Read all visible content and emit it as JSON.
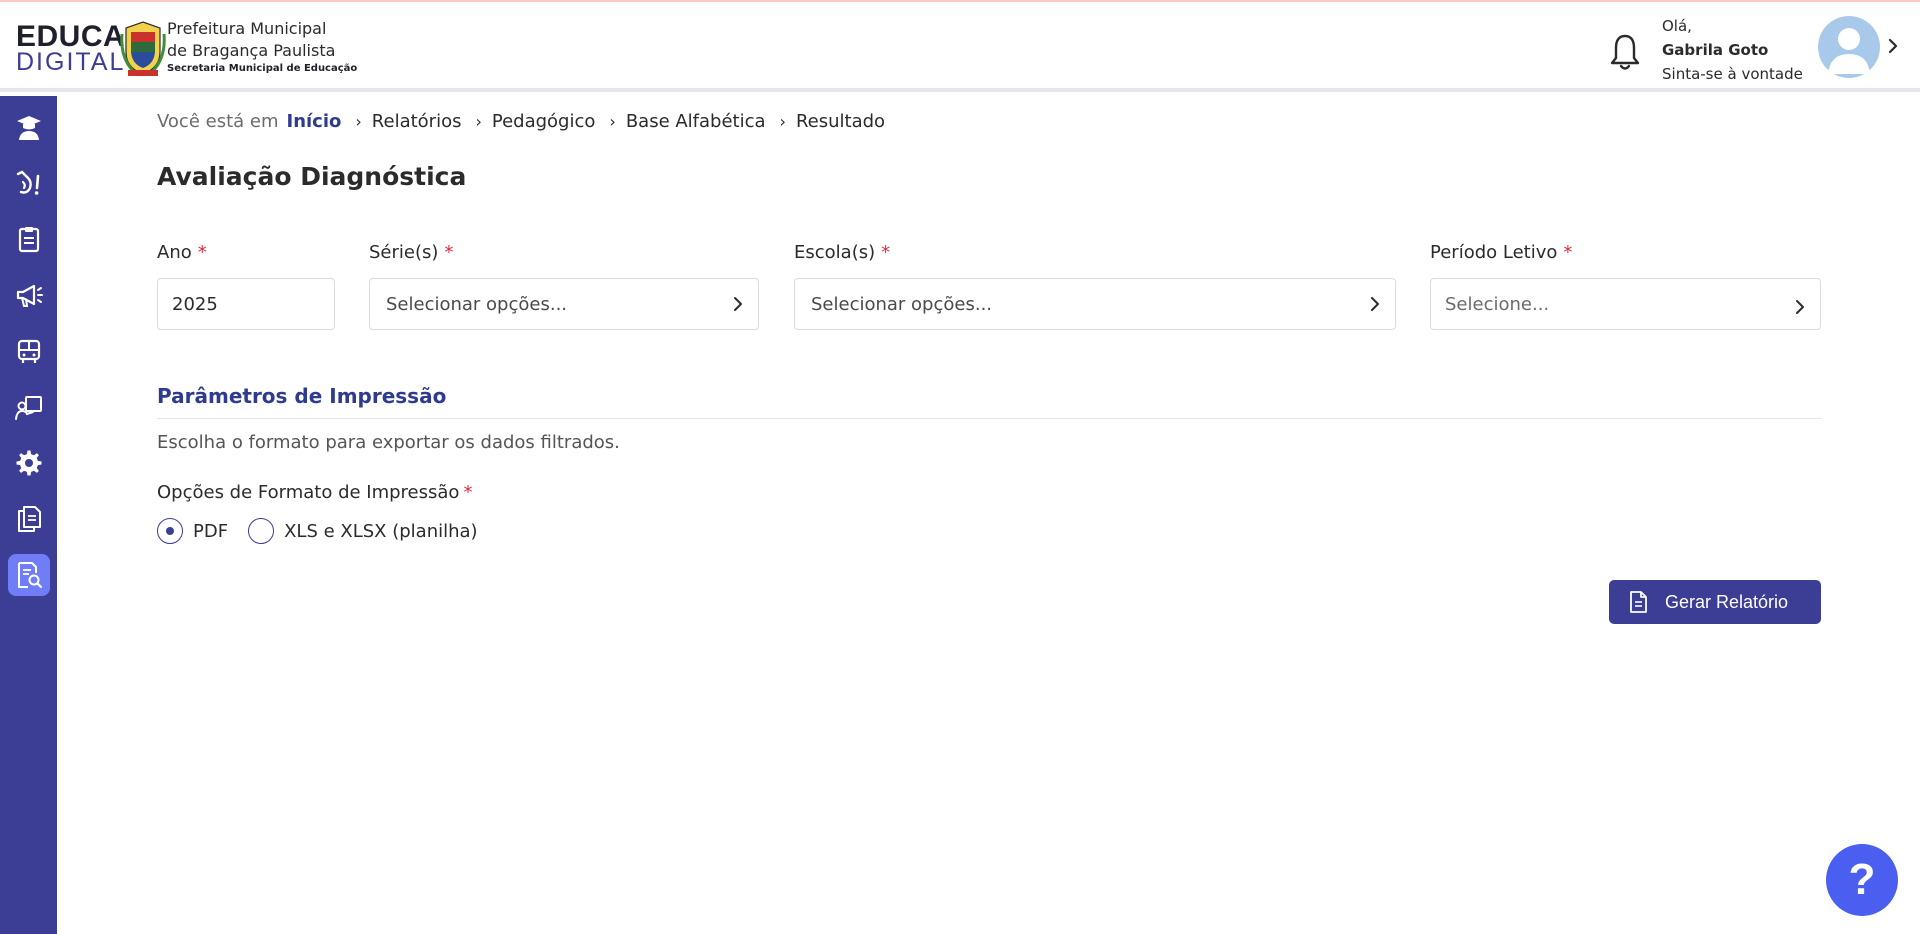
{
  "brand": {
    "educa_line1": "EDUCA",
    "educa_line2": "DIGITAL",
    "prefeitura_line1": "Prefeitura Municipal",
    "prefeitura_line2": "de Bragança Paulista",
    "secretaria": "Secretaria Municipal de Educação",
    "accent_color": "#3c3d94"
  },
  "user": {
    "greeting": "Olá,",
    "name": "Gabrila Goto",
    "subtitle": "Sinta-se à vontade"
  },
  "sidebar": {
    "items": [
      {
        "icon": "graduate-icon"
      },
      {
        "icon": "hand-alert-icon"
      },
      {
        "icon": "clipboard-icon"
      },
      {
        "icon": "megaphone-icon"
      },
      {
        "icon": "bus-icon"
      },
      {
        "icon": "teacher-board-icon"
      },
      {
        "icon": "gear-icon"
      },
      {
        "icon": "documents-icon"
      },
      {
        "icon": "report-search-icon",
        "active": true
      }
    ]
  },
  "breadcrumb": {
    "prefix": "Você está em",
    "home": "Início",
    "items": [
      "Relatórios",
      "Pedagógico",
      "Base Alfabética",
      "Resultado"
    ]
  },
  "page": {
    "title": "Avaliação Diagnóstica"
  },
  "filters": {
    "ano": {
      "label": "Ano",
      "required": "*",
      "value": "2025"
    },
    "series": {
      "label": "Série(s)",
      "required": "*",
      "placeholder": "Selecionar opções..."
    },
    "escolas": {
      "label": "Escola(s)",
      "required": "*",
      "placeholder": "Selecionar opções..."
    },
    "periodo": {
      "label": "Período Letivo",
      "required": "*",
      "placeholder": "Selecione..."
    }
  },
  "print": {
    "section_title": "Parâmetros de Impressão",
    "description": "Escolha o formato para exportar os dados filtrados.",
    "options_label": "Opções de Formato de Impressão",
    "required": "*",
    "options": [
      {
        "label": "PDF",
        "selected": true
      },
      {
        "label": "XLS e XLSX (planilha)",
        "selected": false
      }
    ]
  },
  "actions": {
    "generate_label": "Gerar Relatório"
  },
  "help": {
    "label": "?"
  }
}
